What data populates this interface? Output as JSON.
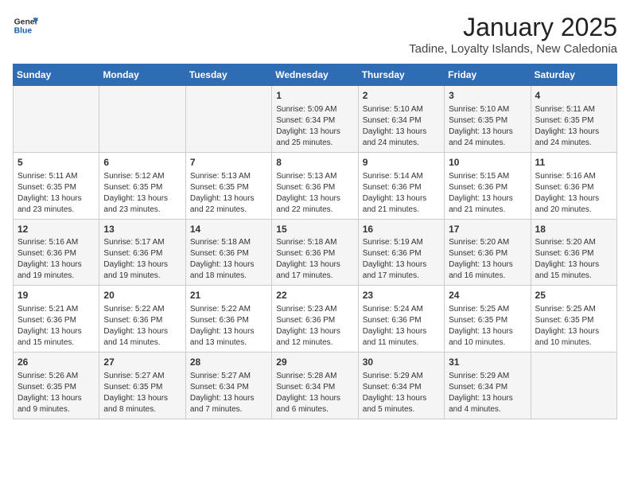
{
  "header": {
    "logo_general": "General",
    "logo_blue": "Blue",
    "title": "January 2025",
    "subtitle": "Tadine, Loyalty Islands, New Caledonia"
  },
  "weekdays": [
    "Sunday",
    "Monday",
    "Tuesday",
    "Wednesday",
    "Thursday",
    "Friday",
    "Saturday"
  ],
  "weeks": [
    [
      {
        "day": "",
        "content": ""
      },
      {
        "day": "",
        "content": ""
      },
      {
        "day": "",
        "content": ""
      },
      {
        "day": "1",
        "content": "Sunrise: 5:09 AM\nSunset: 6:34 PM\nDaylight: 13 hours\nand 25 minutes."
      },
      {
        "day": "2",
        "content": "Sunrise: 5:10 AM\nSunset: 6:34 PM\nDaylight: 13 hours\nand 24 minutes."
      },
      {
        "day": "3",
        "content": "Sunrise: 5:10 AM\nSunset: 6:35 PM\nDaylight: 13 hours\nand 24 minutes."
      },
      {
        "day": "4",
        "content": "Sunrise: 5:11 AM\nSunset: 6:35 PM\nDaylight: 13 hours\nand 24 minutes."
      }
    ],
    [
      {
        "day": "5",
        "content": "Sunrise: 5:11 AM\nSunset: 6:35 PM\nDaylight: 13 hours\nand 23 minutes."
      },
      {
        "day": "6",
        "content": "Sunrise: 5:12 AM\nSunset: 6:35 PM\nDaylight: 13 hours\nand 23 minutes."
      },
      {
        "day": "7",
        "content": "Sunrise: 5:13 AM\nSunset: 6:35 PM\nDaylight: 13 hours\nand 22 minutes."
      },
      {
        "day": "8",
        "content": "Sunrise: 5:13 AM\nSunset: 6:36 PM\nDaylight: 13 hours\nand 22 minutes."
      },
      {
        "day": "9",
        "content": "Sunrise: 5:14 AM\nSunset: 6:36 PM\nDaylight: 13 hours\nand 21 minutes."
      },
      {
        "day": "10",
        "content": "Sunrise: 5:15 AM\nSunset: 6:36 PM\nDaylight: 13 hours\nand 21 minutes."
      },
      {
        "day": "11",
        "content": "Sunrise: 5:16 AM\nSunset: 6:36 PM\nDaylight: 13 hours\nand 20 minutes."
      }
    ],
    [
      {
        "day": "12",
        "content": "Sunrise: 5:16 AM\nSunset: 6:36 PM\nDaylight: 13 hours\nand 19 minutes."
      },
      {
        "day": "13",
        "content": "Sunrise: 5:17 AM\nSunset: 6:36 PM\nDaylight: 13 hours\nand 19 minutes."
      },
      {
        "day": "14",
        "content": "Sunrise: 5:18 AM\nSunset: 6:36 PM\nDaylight: 13 hours\nand 18 minutes."
      },
      {
        "day": "15",
        "content": "Sunrise: 5:18 AM\nSunset: 6:36 PM\nDaylight: 13 hours\nand 17 minutes."
      },
      {
        "day": "16",
        "content": "Sunrise: 5:19 AM\nSunset: 6:36 PM\nDaylight: 13 hours\nand 17 minutes."
      },
      {
        "day": "17",
        "content": "Sunrise: 5:20 AM\nSunset: 6:36 PM\nDaylight: 13 hours\nand 16 minutes."
      },
      {
        "day": "18",
        "content": "Sunrise: 5:20 AM\nSunset: 6:36 PM\nDaylight: 13 hours\nand 15 minutes."
      }
    ],
    [
      {
        "day": "19",
        "content": "Sunrise: 5:21 AM\nSunset: 6:36 PM\nDaylight: 13 hours\nand 15 minutes."
      },
      {
        "day": "20",
        "content": "Sunrise: 5:22 AM\nSunset: 6:36 PM\nDaylight: 13 hours\nand 14 minutes."
      },
      {
        "day": "21",
        "content": "Sunrise: 5:22 AM\nSunset: 6:36 PM\nDaylight: 13 hours\nand 13 minutes."
      },
      {
        "day": "22",
        "content": "Sunrise: 5:23 AM\nSunset: 6:36 PM\nDaylight: 13 hours\nand 12 minutes."
      },
      {
        "day": "23",
        "content": "Sunrise: 5:24 AM\nSunset: 6:36 PM\nDaylight: 13 hours\nand 11 minutes."
      },
      {
        "day": "24",
        "content": "Sunrise: 5:25 AM\nSunset: 6:35 PM\nDaylight: 13 hours\nand 10 minutes."
      },
      {
        "day": "25",
        "content": "Sunrise: 5:25 AM\nSunset: 6:35 PM\nDaylight: 13 hours\nand 10 minutes."
      }
    ],
    [
      {
        "day": "26",
        "content": "Sunrise: 5:26 AM\nSunset: 6:35 PM\nDaylight: 13 hours\nand 9 minutes."
      },
      {
        "day": "27",
        "content": "Sunrise: 5:27 AM\nSunset: 6:35 PM\nDaylight: 13 hours\nand 8 minutes."
      },
      {
        "day": "28",
        "content": "Sunrise: 5:27 AM\nSunset: 6:34 PM\nDaylight: 13 hours\nand 7 minutes."
      },
      {
        "day": "29",
        "content": "Sunrise: 5:28 AM\nSunset: 6:34 PM\nDaylight: 13 hours\nand 6 minutes."
      },
      {
        "day": "30",
        "content": "Sunrise: 5:29 AM\nSunset: 6:34 PM\nDaylight: 13 hours\nand 5 minutes."
      },
      {
        "day": "31",
        "content": "Sunrise: 5:29 AM\nSunset: 6:34 PM\nDaylight: 13 hours\nand 4 minutes."
      },
      {
        "day": "",
        "content": ""
      }
    ]
  ]
}
